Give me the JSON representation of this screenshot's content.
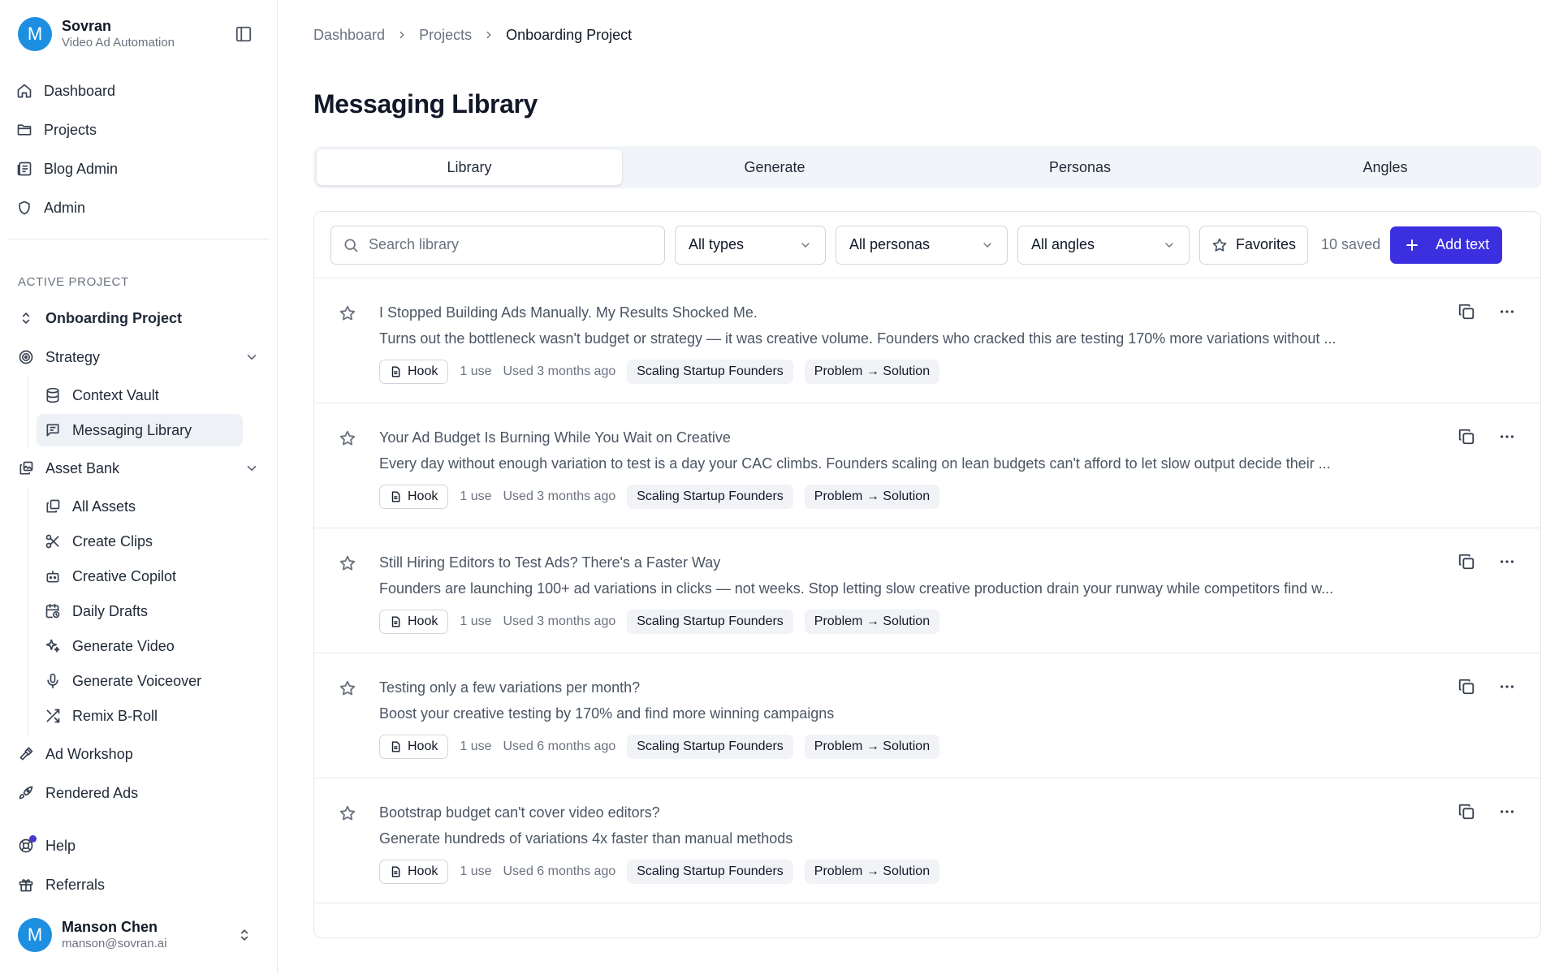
{
  "brand": {
    "avatar_letter": "M",
    "name": "Sovran",
    "subtitle": "Video Ad Automation"
  },
  "nav": [
    {
      "label": "Dashboard",
      "icon": "home-icon"
    },
    {
      "label": "Projects",
      "icon": "folder-icon"
    },
    {
      "label": "Blog Admin",
      "icon": "newspaper-icon"
    },
    {
      "label": "Admin",
      "icon": "shield-icon"
    }
  ],
  "project": {
    "section_label": "ACTIVE PROJECT",
    "name": "Onboarding Project",
    "strategy": {
      "label": "Strategy",
      "items": [
        "Context Vault",
        "Messaging Library"
      ]
    },
    "asset_bank": {
      "label": "Asset Bank",
      "items": [
        "All Assets",
        "Create Clips",
        "Creative Copilot",
        "Daily Drafts",
        "Generate Video",
        "Generate Voiceover",
        "Remix B-Roll"
      ]
    },
    "ad_workshop": "Ad Workshop",
    "rendered_ads": "Rendered Ads"
  },
  "footer_nav": {
    "help": "Help",
    "referrals": "Referrals"
  },
  "user": {
    "avatar_letter": "M",
    "name": "Manson Chen",
    "email": "manson@sovran.ai"
  },
  "breadcrumb": [
    "Dashboard",
    "Projects",
    "Onboarding Project"
  ],
  "page_title": "Messaging Library",
  "tabs": [
    "Library",
    "Generate",
    "Personas",
    "Angles"
  ],
  "active_tab": "Library",
  "toolbar": {
    "search_placeholder": "Search library",
    "type_filter": "All types",
    "persona_filter": "All personas",
    "angle_filter": "All angles",
    "favorites_label": "Favorites",
    "saved_count": "10 saved",
    "add_label": "Add text"
  },
  "colors": {
    "accent": "#3b2fe0",
    "avatar": "#1d8fe0",
    "help_dot": "#4338ca"
  },
  "items": [
    {
      "title": "I Stopped Building Ads Manually. My Results Shocked Me.",
      "desc": "Turns out the bottleneck wasn't budget or strategy — it was creative volume. Founders who cracked this are testing 170% more variations without ...",
      "type": "Hook",
      "uses": "1 use",
      "used": "Used 3 months ago",
      "persona": "Scaling Startup Founders",
      "angle": "Problem → Solution"
    },
    {
      "title": "Your Ad Budget Is Burning While You Wait on Creative",
      "desc": "Every day without enough variation to test is a day your CAC climbs. Founders scaling on lean budgets can't afford to let slow output decide their ...",
      "type": "Hook",
      "uses": "1 use",
      "used": "Used 3 months ago",
      "persona": "Scaling Startup Founders",
      "angle": "Problem → Solution"
    },
    {
      "title": "Still Hiring Editors to Test Ads? There's a Faster Way",
      "desc": "Founders are launching 100+ ad variations in clicks — not weeks. Stop letting slow creative production drain your runway while competitors find w...",
      "type": "Hook",
      "uses": "1 use",
      "used": "Used 3 months ago",
      "persona": "Scaling Startup Founders",
      "angle": "Problem → Solution"
    },
    {
      "title": "Testing only a few variations per month?",
      "desc": "Boost your creative testing by 170% and find more winning campaigns",
      "type": "Hook",
      "uses": "1 use",
      "used": "Used 6 months ago",
      "persona": "Scaling Startup Founders",
      "angle": "Problem → Solution"
    },
    {
      "title": "Bootstrap budget can't cover video editors?",
      "desc": "Generate hundreds of variations 4x faster than manual methods",
      "type": "Hook",
      "uses": "1 use",
      "used": "Used 6 months ago",
      "persona": "Scaling Startup Founders",
      "angle": "Problem → Solution"
    }
  ]
}
